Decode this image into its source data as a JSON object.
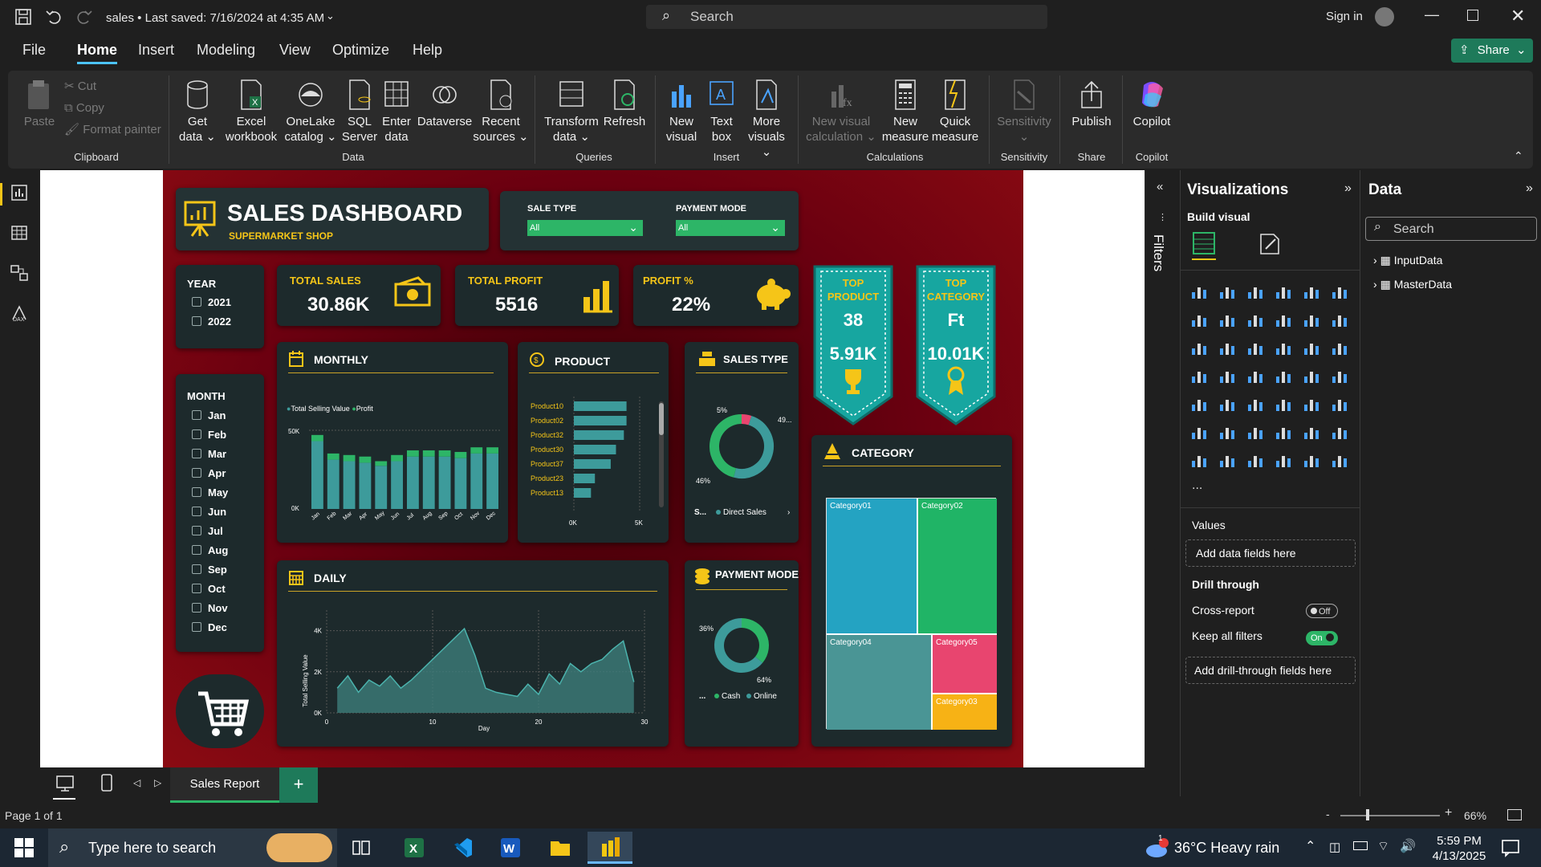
{
  "title_bar": {
    "doc_title": "sales • Last saved: 7/16/2024 at 4:35 AM",
    "search": "Search",
    "sign_in": "Sign in"
  },
  "menu": {
    "items": [
      "File",
      "Home",
      "Insert",
      "Modeling",
      "View",
      "Optimize",
      "Help"
    ],
    "active": "Home",
    "share": "Share"
  },
  "ribbon": {
    "clipboard": {
      "paste": "Paste",
      "cut": "Cut",
      "copy": "Copy",
      "format_painter": "Format painter",
      "group": "Clipboard"
    },
    "data": {
      "get_data": "Get data",
      "excel": "Excel workbook",
      "onelake": "OneLake catalog",
      "sql": "SQL Server",
      "enter": "Enter data",
      "dataverse": "Dataverse",
      "recent": "Recent sources",
      "group": "Data"
    },
    "queries": {
      "transform": "Transform data",
      "refresh": "Refresh",
      "group": "Queries"
    },
    "insert": {
      "new_visual": "New visual",
      "text_box": "Text box",
      "more_visuals": "More visuals",
      "group": "Insert"
    },
    "calculations": {
      "new_visual_calc": "New visual calculation",
      "new_measure": "New measure",
      "quick_measure": "Quick measure",
      "group": "Calculations"
    },
    "sensitivity": {
      "label": "Sensitivity",
      "group": "Sensitivity"
    },
    "share": {
      "publish": "Publish",
      "group": "Share"
    },
    "copilot": {
      "label": "Copilot",
      "group": "Copilot"
    }
  },
  "report": {
    "header": {
      "title": "SALES DASHBOARD",
      "subtitle": "SUPERMARKET SHOP"
    },
    "slicers": {
      "sale_type_label": "SALE TYPE",
      "sale_type_value": "All",
      "payment_mode_label": "PAYMENT MODE",
      "payment_mode_value": "All"
    },
    "year": {
      "label": "YEAR",
      "options": [
        "2021",
        "2022"
      ]
    },
    "month": {
      "label": "MONTH",
      "options": [
        "Jan",
        "Feb",
        "Mar",
        "Apr",
        "May",
        "Jun",
        "Jul",
        "Aug",
        "Sep",
        "Oct",
        "Nov",
        "Dec"
      ]
    },
    "kpis": {
      "total_sales_label": "TOTAL SALES",
      "total_sales": "30.86K",
      "total_profit_label": "TOTAL PROFIT",
      "total_profit": "5516",
      "profit_pct_label": "PROFIT %",
      "profit_pct": "22%"
    },
    "top_product": {
      "label1": "TOP",
      "label2": "PRODUCT",
      "value": "38",
      "amount": "5.91K"
    },
    "top_category": {
      "label1": "TOP",
      "label2": "CATEGORY",
      "value": "Ft",
      "amount": "10.01K"
    },
    "monthly": {
      "title": "MONTHLY",
      "legend": [
        "Total Selling Value",
        "Profit"
      ],
      "y_top": "50K",
      "y_bottom": "0K"
    },
    "product": {
      "title": "PRODUCT",
      "x0": "0K",
      "x1": "5K"
    },
    "sales_type": {
      "title": "SALES TYPE",
      "pct_small": "5%",
      "pct_big": "49...",
      "pct_left": "46%",
      "legend_s": "S...",
      "legend_direct": "Direct Sales"
    },
    "daily": {
      "title": "DAILY",
      "ylabel": "Total Selling Value",
      "xlabel": "Day",
      "yticks": [
        "4K",
        "2K",
        "0K"
      ],
      "xticks": [
        "0",
        "10",
        "20",
        "30"
      ]
    },
    "payment_mode": {
      "title": "PAYMENT MODE",
      "pct_a": "36%",
      "pct_b": "64%",
      "legend_dots": "...",
      "legend_cash": "Cash",
      "legend_online": "Online"
    },
    "category": {
      "title": "CATEGORY",
      "labels": [
        "Category01",
        "Category02",
        "Category04",
        "Category05",
        "Category03"
      ]
    }
  },
  "chart_data": [
    {
      "type": "bar",
      "title": "MONTHLY",
      "categories": [
        "Jan",
        "Feb",
        "Mar",
        "Apr",
        "May",
        "Jun",
        "Jul",
        "Aug",
        "Sep",
        "Oct",
        "Nov",
        "Dec"
      ],
      "series": [
        {
          "name": "Total Selling Value",
          "values": [
            44000,
            32000,
            31000,
            30000,
            28000,
            31000,
            34000,
            34000,
            34000,
            33000,
            36000,
            36000
          ]
        },
        {
          "name": "Profit",
          "values": [
            4000,
            4000,
            4000,
            4000,
            3000,
            4000,
            4000,
            4000,
            4000,
            4000,
            4000,
            4000
          ]
        }
      ],
      "ylim": [
        0,
        50000
      ]
    },
    {
      "type": "bar",
      "title": "PRODUCT",
      "categories": [
        "Product10",
        "Product02",
        "Product32",
        "Product30",
        "Product37",
        "Product23",
        "Product13"
      ],
      "values": [
        4000,
        4000,
        3800,
        3200,
        2800,
        1600,
        1300
      ],
      "xlim": [
        0,
        5000
      ]
    },
    {
      "type": "pie",
      "title": "SALES TYPE",
      "values": [
        5,
        49,
        46
      ]
    },
    {
      "type": "line",
      "title": "DAILY",
      "x": [
        1,
        2,
        3,
        4,
        5,
        6,
        7,
        8,
        9,
        10,
        11,
        12,
        13,
        14,
        15,
        16,
        17,
        18,
        19,
        20,
        21,
        22,
        23,
        24,
        25,
        26,
        27,
        28,
        29
      ],
      "values": [
        1200,
        1800,
        1000,
        1600,
        1300,
        1800,
        1200,
        1600,
        2100,
        2600,
        3100,
        3600,
        4100,
        2800,
        1200,
        1000,
        900,
        800,
        1400,
        900,
        1900,
        1400,
        2400,
        2000,
        2400,
        2600,
        3100,
        3500,
        1500
      ],
      "xlim": [
        0,
        30
      ],
      "ylim": [
        0,
        5000
      ]
    },
    {
      "type": "pie",
      "title": "PAYMENT MODE",
      "values": [
        36,
        64
      ]
    },
    {
      "type": "heatmap",
      "title": "CATEGORY",
      "categories": [
        "Category01",
        "Category02",
        "Category04",
        "Category05",
        "Category03"
      ]
    }
  ],
  "visualizations": {
    "title": "Visualizations",
    "build": "Build visual",
    "values": "Values",
    "add_fields": "Add data fields here",
    "drill": "Drill through",
    "cross_report": "Cross-report",
    "cross_state": "Off",
    "keep_filters": "Keep all filters",
    "keep_state": "On",
    "add_drill": "Add drill-through fields here",
    "more": "..."
  },
  "filters": {
    "label": "Filters"
  },
  "data_pane": {
    "title": "Data",
    "search": "Search",
    "tables": [
      "InputData",
      "MasterData"
    ]
  },
  "tabs": {
    "page": "Sales Report"
  },
  "status": {
    "page": "Page 1 of 1",
    "zoom": "66%"
  },
  "taskbar": {
    "search": "Type here to search",
    "weather": "36°C  Heavy rain",
    "time": "5:59 PM",
    "date": "4/13/2025",
    "badge": "1"
  },
  "colors": {
    "accent": "#f5c518",
    "teal": "#3d9b9b",
    "green": "#2db567",
    "ribbon_bg": "#2b2b2b"
  }
}
